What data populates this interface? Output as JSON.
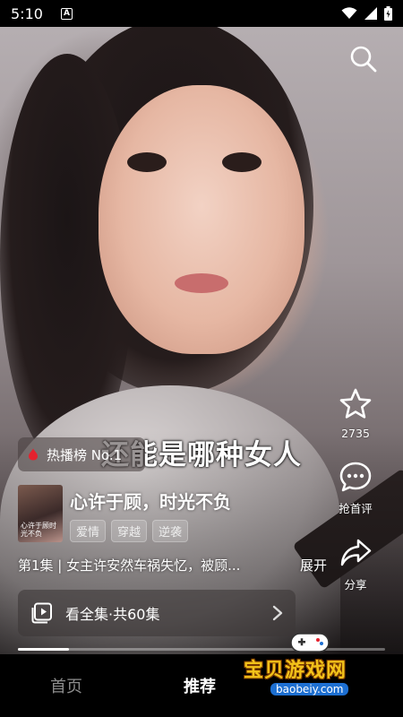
{
  "status_bar": {
    "time": "5:10",
    "notification_badge": "A"
  },
  "video": {
    "subtitle": "还能是哪种女人",
    "hot_badge": "热播榜 No.1"
  },
  "actions": {
    "favorite_count": "2735",
    "comment_label": "抢首评",
    "share_label": "分享"
  },
  "drama": {
    "cover_text": "心许于顾时光不负",
    "title": "心许于顾，时光不负",
    "tags": [
      "爱情",
      "穿越",
      "逆袭"
    ],
    "episode_summary": "第1集 | 女主许安然车祸失忆，被顾...",
    "expand_label": "展开",
    "watch_all_label": "看全集·共60集",
    "progress_fraction": 0.14
  },
  "bottom_nav": {
    "home": "首页",
    "recommend": "推荐"
  },
  "watermark": {
    "title": "宝贝游戏网",
    "url": "baobeiy.com"
  },
  "colors": {
    "accent_red": "#e5222e",
    "watermark_yellow": "#f2c21a",
    "watermark_blue": "#1d6fd1"
  }
}
